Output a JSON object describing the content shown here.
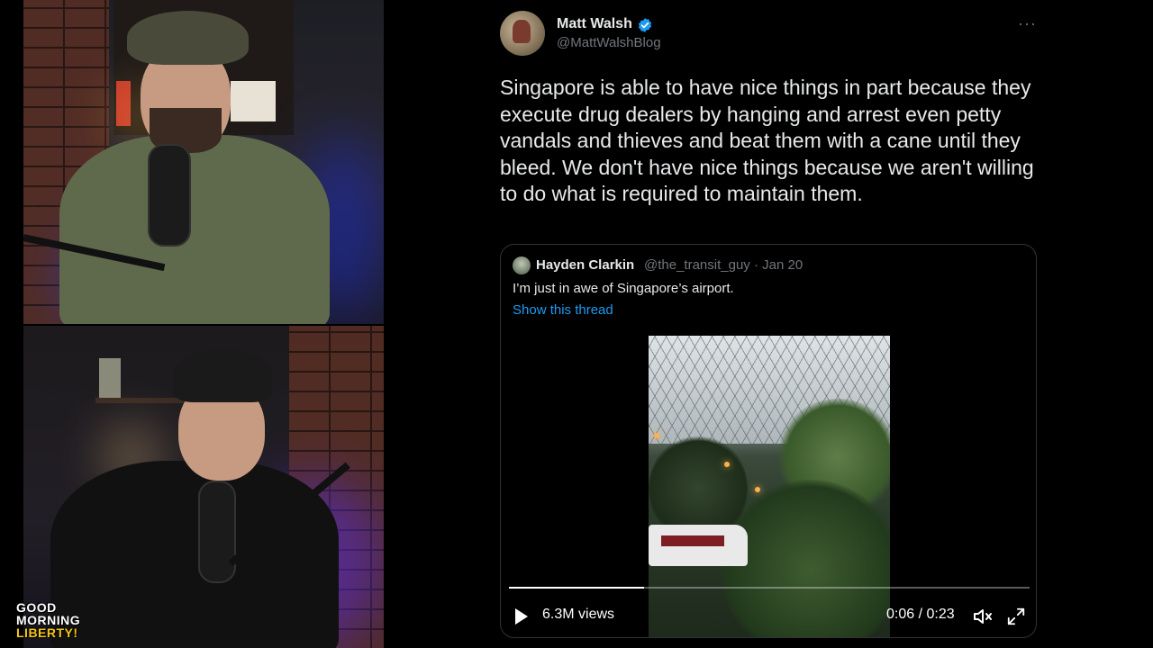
{
  "tweet": {
    "author_name": "Matt Walsh",
    "author_handle": "@MattWalshBlog",
    "more_label": "···",
    "text": "Singapore is able to have nice things in part because they execute drug dealers by hanging and arrest even petty vandals and thieves and beat them with a cane until they bleed. We don't have nice things because we aren't willing to do what is required to maintain them."
  },
  "quote": {
    "author_name": "Hayden Clarkin",
    "author_handle_date": "@the_transit_guy · Jan 20",
    "text": "I’m just in awe of Singapore’s airport.",
    "show_thread": "Show this thread"
  },
  "video": {
    "views": "6.3M views",
    "time": "0:06 / 0:23",
    "progress": 0.26
  },
  "logo": {
    "line1": "GOOD",
    "line2": "MORNING",
    "line3": "LIBERTY!"
  },
  "colors": {
    "accent": "#1d9bf0",
    "text": "#e7e9ea",
    "secondary": "#71767b",
    "border": "#2f3336"
  },
  "icons": [
    "verified-badge-icon",
    "more-options-icon",
    "play-icon",
    "mute-icon",
    "fullscreen-icon"
  ]
}
